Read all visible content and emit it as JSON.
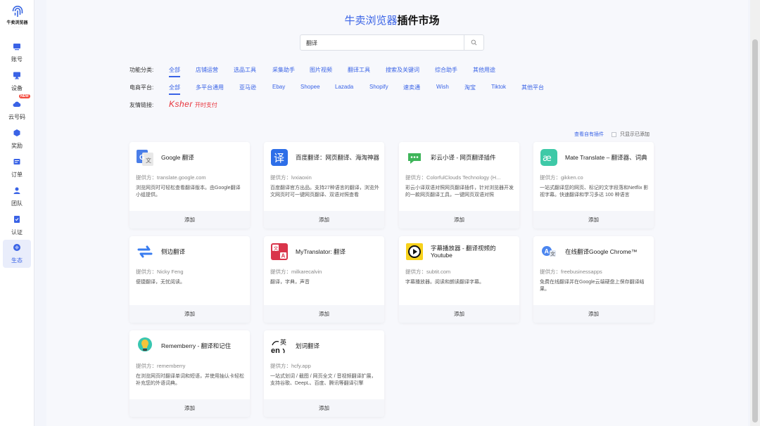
{
  "logo": {
    "name": "牛卖浏览器"
  },
  "sidebar": {
    "items": [
      {
        "label": "账号",
        "badge": ""
      },
      {
        "label": "设备",
        "badge": ""
      },
      {
        "label": "云号码",
        "badge": "NEW"
      },
      {
        "label": "奖励",
        "badge": ""
      },
      {
        "label": "订单",
        "badge": ""
      },
      {
        "label": "团队",
        "badge": ""
      },
      {
        "label": "认证",
        "badge": ""
      },
      {
        "label": "生态",
        "badge": ""
      }
    ]
  },
  "header": {
    "title_highlight": "牛卖浏览器",
    "title_rest": "插件市场"
  },
  "search": {
    "value": "翻译",
    "icon": "search-icon"
  },
  "filters": {
    "category": {
      "label": "功能分类:",
      "options": [
        "全部",
        "店铺运营",
        "选品工具",
        "采集助手",
        "图片视频",
        "翻译工具",
        "搜索及关键词",
        "综合助手",
        "其他用途"
      ],
      "active": 0
    },
    "platform": {
      "label": "电商平台:",
      "options": [
        "全部",
        "多平台通用",
        "亚马逊",
        "Ebay",
        "Shopee",
        "Lazada",
        "Shopify",
        "速卖通",
        "Wish",
        "淘宝",
        "Tiktok",
        "其他平台"
      ],
      "active": 0
    },
    "links": {
      "label": "友情链接:",
      "ksher_logo": "Ksher",
      "ksher_text": "开时支付"
    }
  },
  "toolbar": {
    "own_link": "查看自有插件",
    "only_added": "只显示已添加"
  },
  "cards": [
    {
      "name": "Google 翻译",
      "provider": "提供方：translate.google.com",
      "desc": "浏览网页时可轻松查看翻译版本。由Google翻译小组提供。",
      "button": "添加",
      "icon": "google-translate-icon"
    },
    {
      "name": "百度翻译：网页翻译、海淘神器",
      "provider": "提供方：lvxiaoxin",
      "desc": "百度翻译官方出品。支持27种语言的翻译，浏览外文网页时可一键网页翻译、双语对照查看",
      "button": "添加",
      "icon": "baidu-translate-icon"
    },
    {
      "name": "彩云小译 - 网页翻译插件",
      "provider": "提供方：ColorfulClouds Technology (H...",
      "desc": "彩云小译双语对照网页翻译插件，针对浏览器开发的一款网页翻译工具，一键网页双语对照",
      "button": "添加",
      "icon": "caiyun-translate-icon"
    },
    {
      "name": "Mate Translate – 翻译器、词典",
      "provider": "提供方：gikken.co",
      "desc": "一站式翻译您的网页、标记的文字段落和Netflix 影视字幕。快速翻译和学习多达 100 种语言",
      "button": "添加",
      "icon": "mate-translate-icon"
    },
    {
      "name": "侧边翻译",
      "provider": "提供方：Nicky Feng",
      "desc": "便捷翻译，无忧阅读。",
      "button": "添加",
      "icon": "side-translate-icon"
    },
    {
      "name": "MyTranslator: 翻译",
      "provider": "提供方：milkarecalvin",
      "desc": "翻译，字典，声音",
      "button": "添加",
      "icon": "mytranslator-icon"
    },
    {
      "name": "字幕播放器 - 翻译视频的Youtube",
      "provider": "提供方：subtit.com",
      "desc": "字幕播放器。阅读和朗读翻译字幕。",
      "button": "添加",
      "icon": "subtitle-player-icon"
    },
    {
      "name": "在线翻译Google Chrome™",
      "provider": "提供方：freebusinessapps",
      "desc": "免费在线翻译并在Google云端硬盘上保存翻译结果。",
      "button": "添加",
      "icon": "online-translate-icon"
    },
    {
      "name": "Rememberry - 翻译和记住",
      "provider": "提供方：rememberry",
      "desc": "在浏览网页时翻译单词和短语，并使用抽认卡轻松补充您的外语词典。",
      "button": "添加",
      "icon": "rememberry-icon"
    },
    {
      "name": "划词翻译",
      "provider": "提供方：hcfy.app",
      "desc": "一站式划词 / 截图 / 网页全文 / 音视频翻译扩展，支持谷歌、DeepL、百度、腾讯等翻译引擎",
      "button": "添加",
      "icon": "hcfy-icon"
    }
  ],
  "colors": {
    "accent": "#3a63e6",
    "ksher": "#e8323a",
    "badge": "#f24b3f"
  }
}
